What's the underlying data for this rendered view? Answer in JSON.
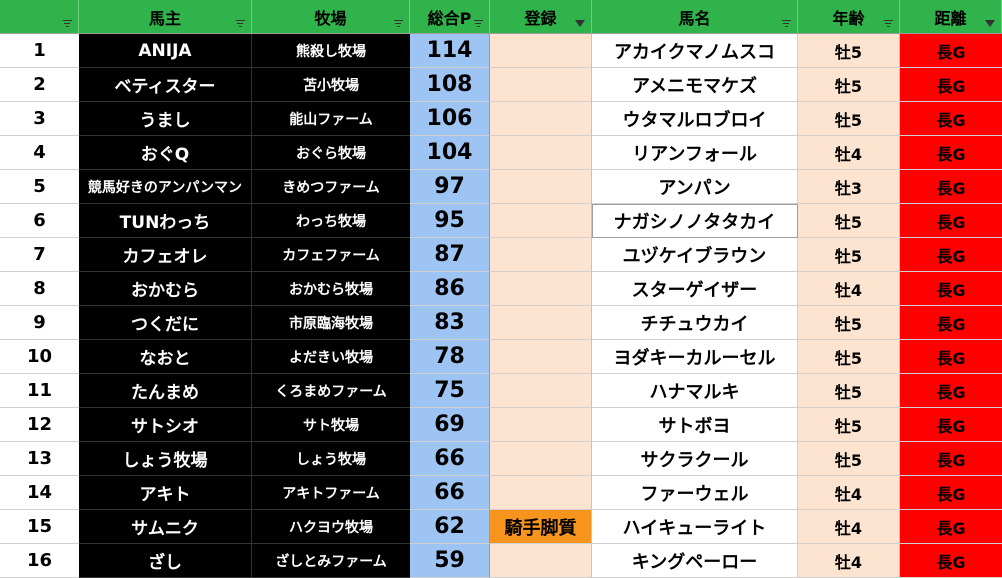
{
  "header": {
    "number": "",
    "owner": "馬主",
    "ranch": "牧場",
    "points": "総合P",
    "registration": "登録",
    "horse": "馬名",
    "age": "年齢",
    "distance": "距離"
  },
  "rows": [
    {
      "no": "1",
      "owner": "ANIJA",
      "ranch": "熊殺し牧場",
      "points": "114",
      "reg": "",
      "horse": "アカイクマノムスコ",
      "age": "牡5",
      "dist": "長G"
    },
    {
      "no": "2",
      "owner": "ベティスター",
      "ranch": "苫小牧場",
      "points": "108",
      "reg": "",
      "horse": "アメニモマケズ",
      "age": "牡5",
      "dist": "長G"
    },
    {
      "no": "3",
      "owner": "うまし",
      "ranch": "能山ファーム",
      "points": "106",
      "reg": "",
      "horse": "ウタマルロブロイ",
      "age": "牡5",
      "dist": "長G"
    },
    {
      "no": "4",
      "owner": "おぐQ",
      "ranch": "おぐら牧場",
      "points": "104",
      "reg": "",
      "horse": "リアンフォール",
      "age": "牡4",
      "dist": "長G"
    },
    {
      "no": "5",
      "owner": "競馬好きのアンパンマン",
      "ranch": "きめつファーム",
      "points": "97",
      "reg": "",
      "horse": "アンパン",
      "age": "牡3",
      "dist": "長G"
    },
    {
      "no": "6",
      "owner": "TUNわっち",
      "ranch": "わっち牧場",
      "points": "95",
      "reg": "",
      "horse": "ナガシノノタタカイ",
      "age": "牡5",
      "dist": "長G"
    },
    {
      "no": "7",
      "owner": "カフェオレ",
      "ranch": "カフェファーム",
      "points": "87",
      "reg": "",
      "horse": "ユヅケイブラウン",
      "age": "牡5",
      "dist": "長G"
    },
    {
      "no": "8",
      "owner": "おかむら",
      "ranch": "おかむら牧場",
      "points": "86",
      "reg": "",
      "horse": "スターゲイザー",
      "age": "牡4",
      "dist": "長G"
    },
    {
      "no": "9",
      "owner": "つくだに",
      "ranch": "市原臨海牧場",
      "points": "83",
      "reg": "",
      "horse": "チチュウカイ",
      "age": "牡5",
      "dist": "長G"
    },
    {
      "no": "10",
      "owner": "なおと",
      "ranch": "よだきい牧場",
      "points": "78",
      "reg": "",
      "horse": "ヨダキーカルーセル",
      "age": "牡5",
      "dist": "長G"
    },
    {
      "no": "11",
      "owner": "たんまめ",
      "ranch": "くろまめファーム",
      "points": "75",
      "reg": "",
      "horse": "ハナマルキ",
      "age": "牡5",
      "dist": "長G"
    },
    {
      "no": "12",
      "owner": "サトシオ",
      "ranch": "サト牧場",
      "points": "69",
      "reg": "",
      "horse": "サトボヨ",
      "age": "牡5",
      "dist": "長G"
    },
    {
      "no": "13",
      "owner": "しょう牧場",
      "ranch": "しょう牧場",
      "points": "66",
      "reg": "",
      "horse": "サクラクール",
      "age": "牡5",
      "dist": "長G"
    },
    {
      "no": "14",
      "owner": "アキト",
      "ranch": "アキトファーム",
      "points": "66",
      "reg": "",
      "horse": "ファーウェル",
      "age": "牡4",
      "dist": "長G"
    },
    {
      "no": "15",
      "owner": "サムニク",
      "ranch": "ハクヨウ牧場",
      "points": "62",
      "reg": "騎手脚質",
      "horse": "ハイキューライト",
      "age": "牡4",
      "dist": "長G"
    },
    {
      "no": "16",
      "owner": "ざし",
      "ranch": "ざしとみファーム",
      "points": "59",
      "reg": "",
      "horse": "キングペーロー",
      "age": "牡4",
      "dist": "長G"
    }
  ],
  "colors": {
    "header_bg": "#2fb34a",
    "owner_bg": "#000000",
    "points_bg": "#9ec4f4",
    "peach_bg": "#fce4d0",
    "flag_bg": "#f7941d",
    "distance_bg": "#ff0000"
  }
}
